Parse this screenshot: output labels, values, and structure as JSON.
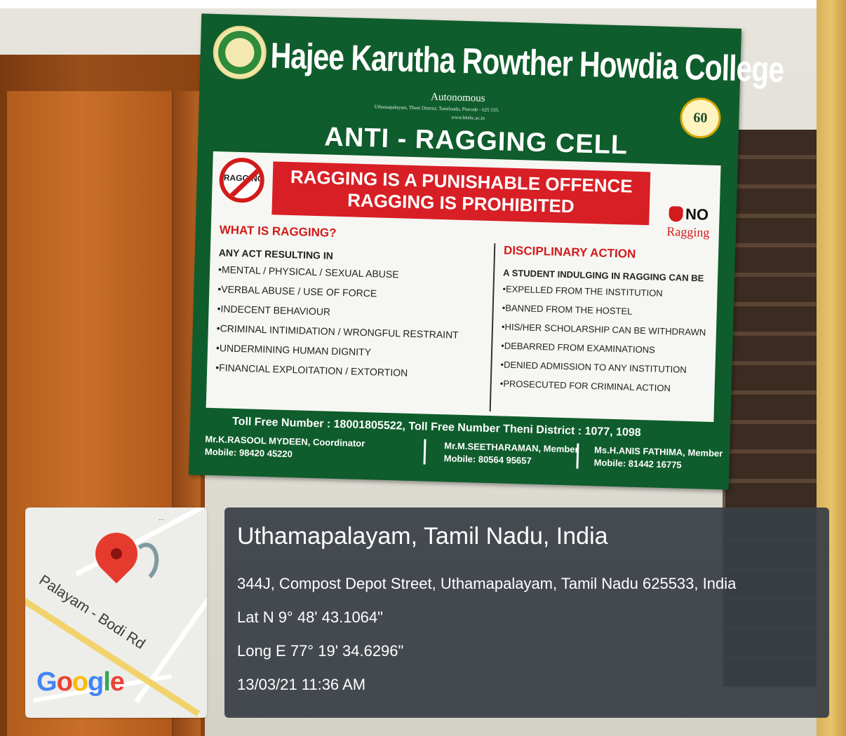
{
  "banner": {
    "college_name": "Hajee Karutha Rowther Howdia College",
    "autonomous": "Autonomous",
    "address": "Uthamapalayam, Theni District, Tamilnadu, Pincode - 625 533.",
    "website": "www.hkrhc.ac.in",
    "anniversary": "60",
    "title": "ANTI - RAGGING CELL",
    "no_sign_text": "RAGGING",
    "headline_1": "RAGGING IS A PUNISHABLE OFFENCE",
    "headline_2": "RAGGING IS PROHIBITED",
    "no_label": "NO",
    "ragging_label": "Ragging",
    "what_is": {
      "heading": "WHAT IS RAGGING?",
      "intro": "ANY ACT RESULTING IN",
      "items": [
        "MENTAL / PHYSICAL / SEXUAL ABUSE",
        "VERBAL ABUSE / USE OF FORCE",
        "INDECENT BEHAVIOUR",
        "CRIMINAL INTIMIDATION / WRONGFUL RESTRAINT",
        "UNDERMINING HUMAN DIGNITY",
        "FINANCIAL EXPLOITATION / EXTORTION"
      ]
    },
    "disciplinary": {
      "heading": "DISCIPLINARY ACTION",
      "intro": "A STUDENT INDULGING IN RAGGING CAN BE",
      "items": [
        "EXPELLED FROM THE INSTITUTION",
        "BANNED FROM THE HOSTEL",
        "HIS/HER SCHOLARSHIP CAN BE WITHDRAWN",
        "DEBARRED FROM EXAMINATIONS",
        "DENIED ADMISSION TO ANY INSTITUTION",
        "PROSECUTED FOR CRIMINAL ACTION"
      ]
    },
    "toll_free": "Toll Free Number : 18001805522, Toll Free Number Theni District : 1077, 1098",
    "contacts": [
      {
        "name": "Mr.K.RASOOL MYDEEN, Coordinator",
        "mobile": "Mobile: 98420 45220"
      },
      {
        "name": "Mr.M.SEETHARAMAN, Member",
        "mobile": "Mobile: 80564 95657"
      },
      {
        "name": "Ms.H.ANIS FATHIMA, Member",
        "mobile": "Mobile: 81442 16775"
      }
    ]
  },
  "map": {
    "road_label": "Palayam - Bodi Rd",
    "more_dots": "...",
    "google_letters": [
      "G",
      "o",
      "o",
      "g",
      "l",
      "e"
    ],
    "icon": "location-pin-icon"
  },
  "location": {
    "place": "Uthamapalayam, Tamil Nadu, India",
    "address": "344J, Compost Depot Street, Uthamapalayam, Tamil Nadu 625533, India",
    "lat": "Lat N 9° 48' 43.1064\"",
    "long": "Long E 77° 19' 34.6296\"",
    "datetime": "13/03/21 11:36 AM"
  },
  "colors": {
    "banner_green": "#0f5d2c",
    "alert_red": "#d81f26",
    "info_card": "#383e46"
  }
}
